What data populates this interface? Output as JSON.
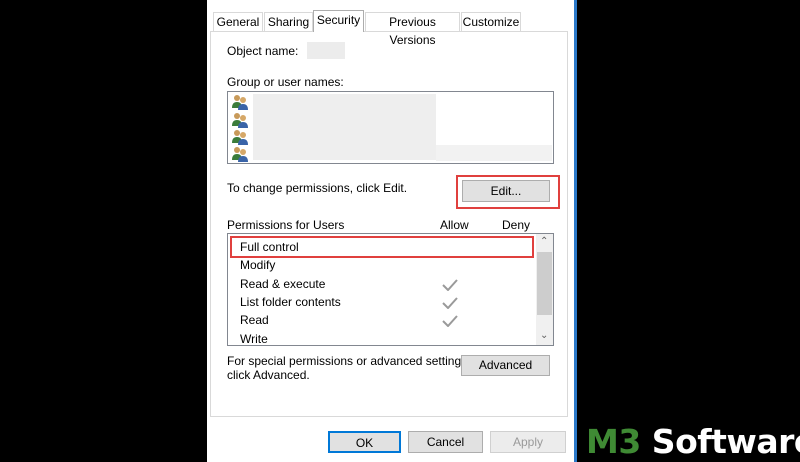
{
  "tabs": [
    "General",
    "Sharing",
    "Security",
    "Previous Versions",
    "Customize"
  ],
  "security": {
    "object_name_label": "Object name:",
    "group_label": "Group or user names:",
    "change_text": "To change permissions, click Edit.",
    "edit_label": "Edit...",
    "permissions_label": "Permissions for Users",
    "allow_header": "Allow",
    "deny_header": "Deny",
    "permissions": [
      {
        "name": "Full control",
        "allow": false,
        "deny": false
      },
      {
        "name": "Modify",
        "allow": false,
        "deny": false
      },
      {
        "name": "Read & execute",
        "allow": true,
        "deny": false
      },
      {
        "name": "List folder contents",
        "allow": true,
        "deny": false
      },
      {
        "name": "Read",
        "allow": true,
        "deny": false
      },
      {
        "name": "Write",
        "allow": false,
        "deny": false
      }
    ],
    "special_line1": "For special permissions or advanced settings,",
    "special_line2": "click Advanced.",
    "advanced_label": "Advanced"
  },
  "footer": {
    "ok_label": "OK",
    "cancel_label": "Cancel",
    "apply_label": "Apply"
  },
  "watermark": {
    "part1": "M3",
    "part2": " Software"
  },
  "colors": {
    "highlight": "#e0403e",
    "window_border": "#2b79c9",
    "logo_green": "#3f8a34",
    "check_gray": "#9a9a9a"
  }
}
